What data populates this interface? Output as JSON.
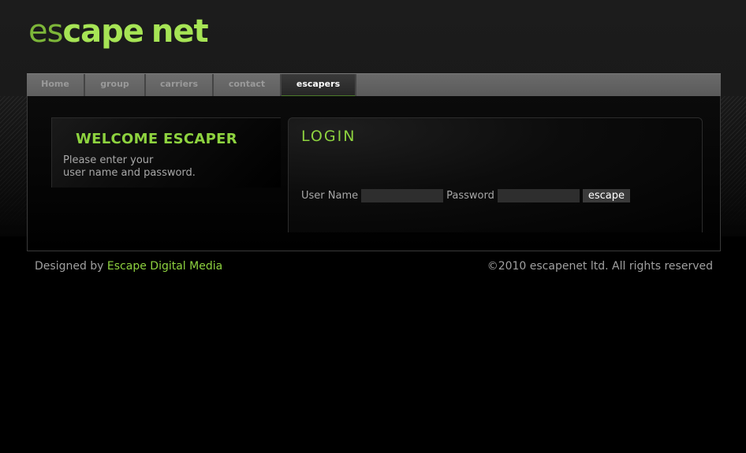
{
  "logo": {
    "part1": "es",
    "part2": "cape",
    "part3": "net"
  },
  "nav": {
    "items": [
      {
        "label": "Home"
      },
      {
        "label": "group"
      },
      {
        "label": "carriers"
      },
      {
        "label": "contact"
      },
      {
        "label": "escapers"
      }
    ],
    "active": "escapers"
  },
  "welcome": {
    "title": "WELCOME ESCAPER",
    "line1": "Please enter your",
    "line2": "user name and password."
  },
  "login": {
    "title": "LOGIN",
    "username_label": "User Name",
    "username_value": "",
    "password_label": "Password",
    "password_value": "",
    "submit_label": "escape"
  },
  "footer": {
    "designed_by": "Designed by",
    "designer": "Escape Digital Media",
    "copyright": "©2010 escapenet ltd. All rights reserved"
  },
  "colors": {
    "accent": "#8ed33f",
    "background": "#000000",
    "nav": "#5e5e5e"
  }
}
